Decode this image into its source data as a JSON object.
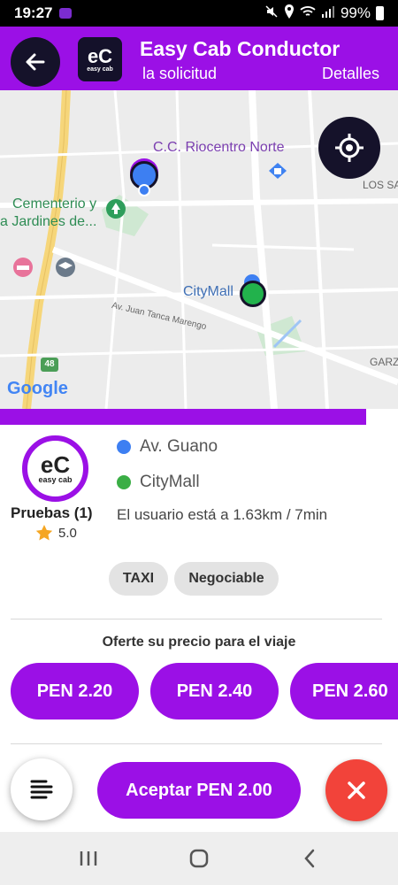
{
  "status_bar": {
    "time": "19:27",
    "battery": "99%"
  },
  "app_bar": {
    "title": "Easy Cab Conductor",
    "subtitle": "la solicitud",
    "details_link": "Detalles",
    "logo_mark": "eC",
    "logo_text": "easy cab"
  },
  "map": {
    "labels": {
      "mall_north": "C.C. Riocentro Norte",
      "cemetery_1": "Cementerio y",
      "cemetery_2": "a Jardines de...",
      "citymall": "CityMall",
      "road": "Av. Juan Tanca Marengo",
      "los_sau": "LOS SAU",
      "garzo": "GARZO",
      "highway": "48"
    },
    "attribution": "Google"
  },
  "progress": {
    "value": 0.92
  },
  "passenger": {
    "avatar_mark": "eC",
    "avatar_text": "easy cab",
    "name": "Pruebas (1)",
    "rating": "5.0"
  },
  "trip": {
    "pickup": "Av. Guano",
    "dropoff": "CityMall",
    "distance": "El usuario está a 1.63km / 7min"
  },
  "chips": [
    "TAXI",
    "Negociable"
  ],
  "offer": {
    "label": "Oferte su precio para el viaje",
    "prices": [
      "PEN 2.20",
      "PEN 2.40",
      "PEN 2.60"
    ]
  },
  "actions": {
    "accept": "Aceptar PEN 2.00"
  },
  "colors": {
    "primary": "#9b10e6",
    "dark": "#15122a",
    "cancel": "#f2433a",
    "pickup_dot": "#3d7ff2",
    "dropoff_dot": "#3aae45",
    "star": "#f5a623"
  }
}
